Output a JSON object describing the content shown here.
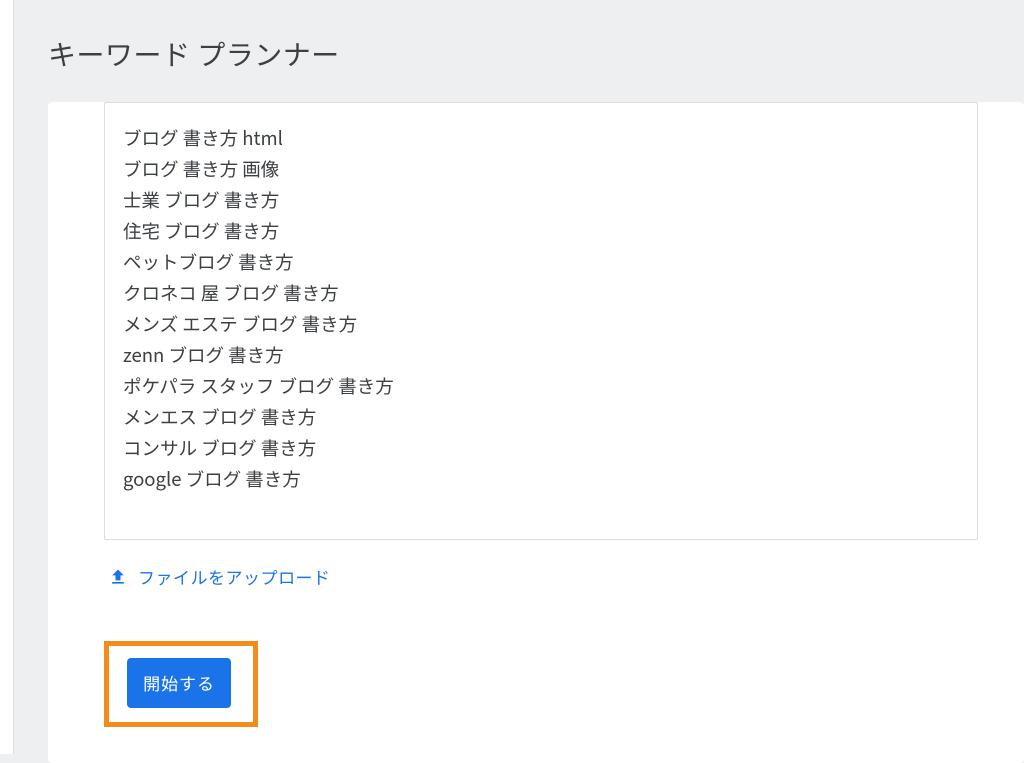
{
  "header": {
    "title": "キーワード プランナー"
  },
  "keyword_box": {
    "lines": [
      "ブログ 書き方 html",
      "ブログ 書き方 画像",
      "士業 ブログ 書き方",
      "住宅 ブログ 書き方",
      "ペットブログ 書き方",
      "クロネコ 屋 ブログ 書き方",
      "メンズ エステ ブログ 書き方",
      "zenn ブログ 書き方",
      "ポケパラ スタッフ ブログ 書き方",
      "メンエス ブログ 書き方",
      "コンサル ブログ 書き方",
      "google ブログ 書き方"
    ]
  },
  "upload": {
    "label": "ファイルをアップロード"
  },
  "actions": {
    "start": "開始する"
  },
  "colors": {
    "accent_blue": "#1a73e8",
    "highlight_orange": "#f28c1a"
  }
}
